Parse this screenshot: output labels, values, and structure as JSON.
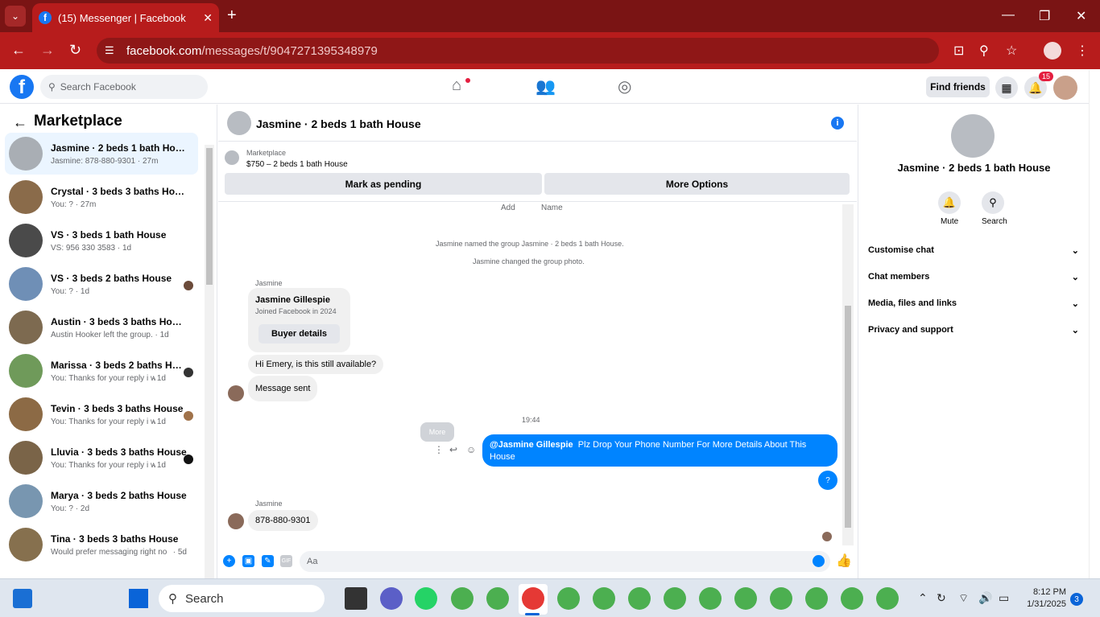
{
  "browser": {
    "tab_title": "(15) Messenger | Facebook",
    "url_host": "facebook.com",
    "url_path": "/messages/t/9047271395348979"
  },
  "fb": {
    "search_placeholder": "Search Facebook",
    "find_friends": "Find friends",
    "notif_count": "15"
  },
  "sidebar": {
    "title": "Marketplace",
    "conversations": [
      {
        "name": "Jasmine · 2 beds 1 bath House",
        "sub": "Jasmine: 878-880-9301 · 27m",
        "time": ""
      },
      {
        "name": "Crystal · 3 beds 3 baths House",
        "sub": "You: ? · 27m",
        "time": ""
      },
      {
        "name": "VS · 3 beds 1 bath House",
        "sub": "VS: 956 330 3583 · 1d",
        "time": ""
      },
      {
        "name": "VS · 3 beds 2 baths House",
        "sub": "You: ? · 1d",
        "time": ""
      },
      {
        "name": "Austin · 3 beds 3 baths House",
        "sub": "Austin Hooker left the group. · 1d",
        "time": ""
      },
      {
        "name": "Marissa · 3 beds 2 baths Hou...",
        "sub": "You: Thanks for your reply i will...",
        "time": "· 1d"
      },
      {
        "name": "Tevin · 3 beds 3 baths House",
        "sub": "You: Thanks for your reply i will...",
        "time": "· 1d"
      },
      {
        "name": "Lluvia · 3 beds 3 baths House",
        "sub": "You: Thanks for your reply i will...",
        "time": "· 1d"
      },
      {
        "name": "Marya · 3 beds 2 baths House",
        "sub": "You: ? · 2d",
        "time": ""
      },
      {
        "name": "Tina · 3 beds 3 baths House",
        "sub": "Would prefer messaging right no...",
        "time": "· 5d"
      }
    ]
  },
  "chat": {
    "title": "Jasmine · 2 beds 1 bath House",
    "marketplace_label": "Marketplace",
    "listing": "$750 – 2 beds 1 bath House",
    "mark_pending": "Mark as pending",
    "more_options": "More Options",
    "add": "Add",
    "name": "Name",
    "event1": "Jasmine named the group Jasmine · 2 beds 1 bath House.",
    "event2": "Jasmine changed the group photo.",
    "sender1": "Jasmine",
    "card_name": "Jasmine Gillespie",
    "card_joined": "Joined Facebook in 2024",
    "buyer_details": "Buyer details",
    "msg1": "Hi Emery, is this still available?",
    "msg2": "Message sent",
    "time1": "19:44",
    "more_tip": "More",
    "out_mention": "@Jasmine Gillespie",
    "out_text": "Plz Drop Your Phone Number For More Details About This House",
    "out_q": "?",
    "sender2": "Jasmine",
    "msg3": "878-880-9301",
    "input_placeholder": "Aa"
  },
  "rpanel": {
    "title": "Jasmine · 2 beds 1 bath House",
    "mute": "Mute",
    "search": "Search",
    "rows": [
      "Customise chat",
      "Chat members",
      "Media, files and links",
      "Privacy and support"
    ]
  },
  "taskbar": {
    "search": "Search",
    "time": "8:12 PM",
    "date": "1/31/2025",
    "notif": "3"
  },
  "colors": {
    "brand": "#1877f2",
    "messenger": "#0084ff",
    "chrome": "#b71c1c"
  }
}
